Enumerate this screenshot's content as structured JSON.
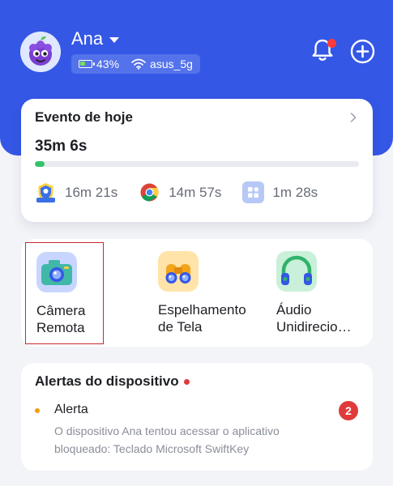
{
  "header": {
    "user_name": "Ana",
    "battery_text": "43%",
    "battery_level": 0.43,
    "wifi_name": "asus_5g",
    "notification_dot": true,
    "colors": {
      "header_bg": "#3457e6",
      "battery_green": "#7ddd5a",
      "notification_red": "#ff3b3b"
    }
  },
  "today": {
    "title": "Evento de hoje",
    "total_time": "35m 6s",
    "progress": 0.03,
    "usage": [
      {
        "icon": "kids-app-icon",
        "time": "16m 21s"
      },
      {
        "icon": "chrome-icon",
        "time": "14m 57s"
      },
      {
        "icon": "apps-grid-icon",
        "time": "1m 28s"
      }
    ],
    "progress_color": "#35c26a"
  },
  "features": [
    {
      "label": "Câmera Remota",
      "icon": "camera-icon",
      "selected": true
    },
    {
      "label": "Espelhamento de Tela",
      "icon": "binoculars-icon",
      "selected": false
    },
    {
      "label": "Áudio Unidirecio…",
      "icon": "headphones-icon",
      "selected": false
    }
  ],
  "alerts": {
    "title": "Alertas do dispositivo",
    "items": [
      {
        "name": "Alerta",
        "text": "O dispositivo Ana tentou acessar o aplicativo bloqueado: Teclado Microsoft SwiftKey",
        "count": "2"
      }
    ]
  }
}
